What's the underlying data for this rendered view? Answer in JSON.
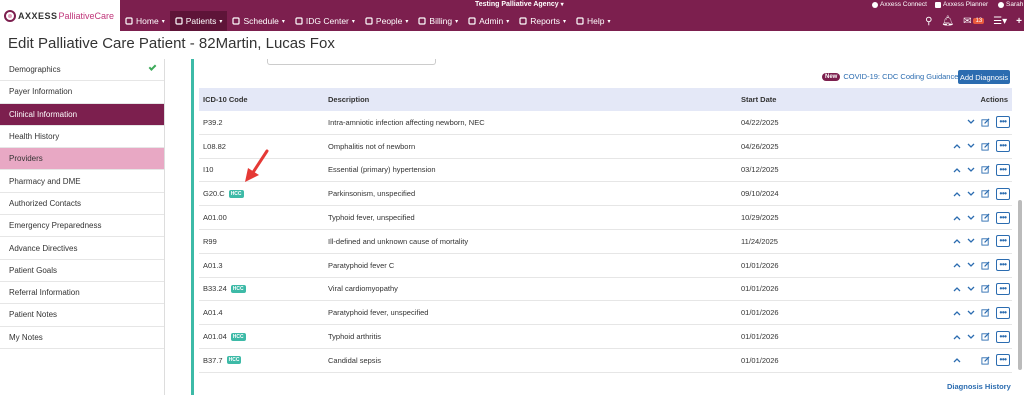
{
  "brand": {
    "name": "AXXESS",
    "product": "PalliativeCare"
  },
  "agency": "Testing Palliative Agency",
  "utilities": [
    {
      "label": "Axxess Connect",
      "icon": "connect-icon"
    },
    {
      "label": "Axxess Planner",
      "icon": "planner-icon"
    },
    {
      "label": "Sarah",
      "icon": "user-icon"
    }
  ],
  "nav": [
    {
      "label": "Home",
      "icon": "home-icon",
      "active": false
    },
    {
      "label": "Patients",
      "icon": "patient-icon",
      "active": true
    },
    {
      "label": "Schedule",
      "icon": "calendar-icon",
      "active": false
    },
    {
      "label": "IDG Center",
      "icon": "group-icon",
      "active": false
    },
    {
      "label": "People",
      "icon": "people-icon",
      "active": false
    },
    {
      "label": "Billing",
      "icon": "billing-icon",
      "active": false
    },
    {
      "label": "Admin",
      "icon": "wrench-icon",
      "active": false
    },
    {
      "label": "Reports",
      "icon": "chart-icon",
      "active": false
    },
    {
      "label": "Help",
      "icon": "help-icon",
      "active": false
    }
  ],
  "messages_count": "13",
  "page_title": "Edit Palliative Care Patient - 82Martin, Lucas Fox",
  "sidebar": [
    {
      "label": "Demographics",
      "state": "complete"
    },
    {
      "label": "Payer Information",
      "state": ""
    },
    {
      "label": "Clinical Information",
      "state": "selected"
    },
    {
      "label": "Health History",
      "state": ""
    },
    {
      "label": "Providers",
      "state": "hover"
    },
    {
      "label": "Pharmacy and DME",
      "state": ""
    },
    {
      "label": "Authorized Contacts",
      "state": ""
    },
    {
      "label": "Emergency Preparedness",
      "state": ""
    },
    {
      "label": "Advance Directives",
      "state": ""
    },
    {
      "label": "Patient Goals",
      "state": ""
    },
    {
      "label": "Referral Information",
      "state": ""
    },
    {
      "label": "Patient Notes",
      "state": ""
    },
    {
      "label": "My Notes",
      "state": ""
    }
  ],
  "covid": {
    "tag": "New",
    "link": "COVID-19: CDC Coding Guidance"
  },
  "add_diagnosis": "Add Diagnosis",
  "table": {
    "headers": {
      "code": "ICD-10 Code",
      "description": "Description",
      "start_date": "Start Date",
      "actions": "Actions"
    },
    "hcc_label": "HCC",
    "rows": [
      {
        "code": "P39.2",
        "hcc": false,
        "description": "Intra-amniotic infection affecting newborn, NEC",
        "start_date": "04/22/2025",
        "up": false,
        "down": true
      },
      {
        "code": "L08.82",
        "hcc": false,
        "description": "Omphalitis not of newborn",
        "start_date": "04/26/2025",
        "up": true,
        "down": true
      },
      {
        "code": "I10",
        "hcc": false,
        "description": "Essential (primary) hypertension",
        "start_date": "03/12/2025",
        "up": true,
        "down": true
      },
      {
        "code": "G20.C",
        "hcc": true,
        "description": "Parkinsonism, unspecified",
        "start_date": "09/10/2024",
        "up": true,
        "down": true
      },
      {
        "code": "A01.00",
        "hcc": false,
        "description": "Typhoid fever, unspecified",
        "start_date": "10/29/2025",
        "up": true,
        "down": true
      },
      {
        "code": "R99",
        "hcc": false,
        "description": "Ill-defined and unknown cause of mortality",
        "start_date": "11/24/2025",
        "up": true,
        "down": true
      },
      {
        "code": "A01.3",
        "hcc": false,
        "description": "Paratyphoid fever C",
        "start_date": "01/01/2026",
        "up": true,
        "down": true
      },
      {
        "code": "B33.24",
        "hcc": true,
        "description": "Viral cardiomyopathy",
        "start_date": "01/01/2026",
        "up": true,
        "down": true
      },
      {
        "code": "A01.4",
        "hcc": false,
        "description": "Paratyphoid fever, unspecified",
        "start_date": "01/01/2026",
        "up": true,
        "down": true
      },
      {
        "code": "A01.04",
        "hcc": true,
        "description": "Typhoid arthritis",
        "start_date": "01/01/2026",
        "up": true,
        "down": true
      },
      {
        "code": "B37.7",
        "hcc": true,
        "description": "Candidal sepsis",
        "start_date": "01/01/2026",
        "up": true,
        "down": false
      }
    ]
  },
  "diagnosis_history": "Diagnosis History",
  "colors": {
    "brand": "#7c1f4e",
    "accent": "#3dbaa7",
    "link": "#2b6cb0",
    "annotation_arrow": "#e53935"
  }
}
